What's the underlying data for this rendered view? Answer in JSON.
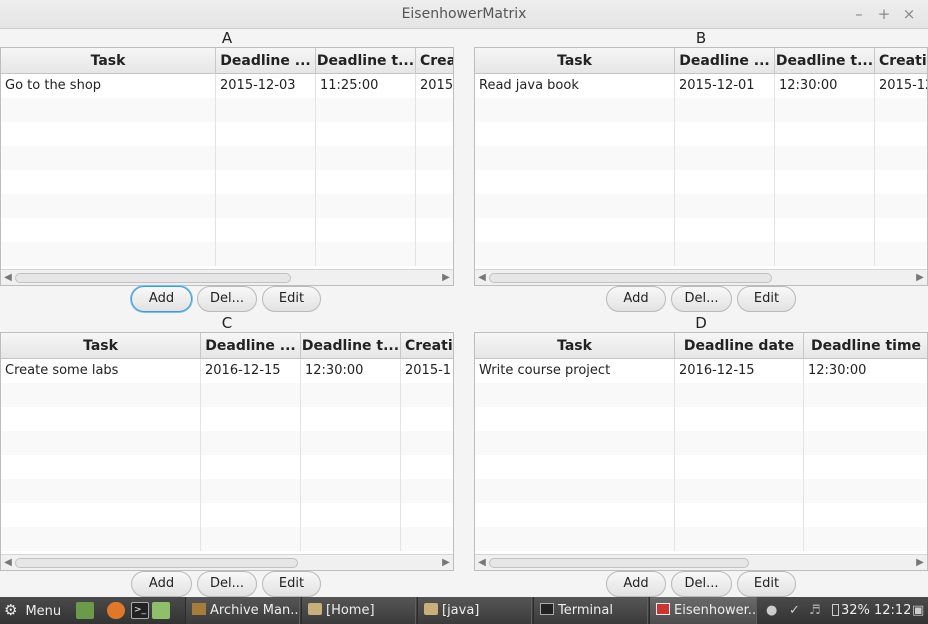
{
  "window": {
    "title": "EisenhowerMatrix",
    "min": "–",
    "max": "+",
    "close": "×"
  },
  "quadrants": [
    {
      "label": "A",
      "columns": [
        "Task",
        "Deadline ...",
        "Deadline t...",
        "Crea"
      ],
      "rows": [
        [
          "Go to the shop",
          "2015-12-03",
          "11:25:00",
          "2015"
        ]
      ],
      "buttons": [
        "Add",
        "Del...",
        "Edit"
      ]
    },
    {
      "label": "B",
      "columns": [
        "Task",
        "Deadline ...",
        "Deadline t...",
        "Creatic"
      ],
      "rows": [
        [
          "Read java book",
          "2015-12-01",
          "12:30:00",
          "2015-12"
        ]
      ],
      "buttons": [
        "Add",
        "Del...",
        "Edit"
      ]
    },
    {
      "label": "C",
      "columns": [
        "Task",
        "Deadline ...",
        "Deadline t...",
        "Creatio"
      ],
      "rows": [
        [
          "Create some labs",
          "2016-12-15",
          "12:30:00",
          "2015-1"
        ]
      ],
      "buttons": [
        "Add",
        "Del...",
        "Edit"
      ]
    },
    {
      "label": "D",
      "columns": [
        "Task",
        "Deadline date",
        "Deadline time"
      ],
      "rows": [
        [
          "Write course project",
          "2016-12-15",
          "12:30:00"
        ]
      ],
      "buttons": [
        "Add",
        "Del...",
        "Edit"
      ]
    }
  ],
  "taskbar": {
    "menu_label": "Menu",
    "windows": [
      "Archive Man...",
      "[Home]",
      "[java]",
      "Terminal",
      "Eisenhower..."
    ],
    "battery": "32%",
    "clock": "12:12"
  },
  "colors": {
    "focus": "#3d9bd8",
    "taskbar": "#3a3a3a"
  }
}
